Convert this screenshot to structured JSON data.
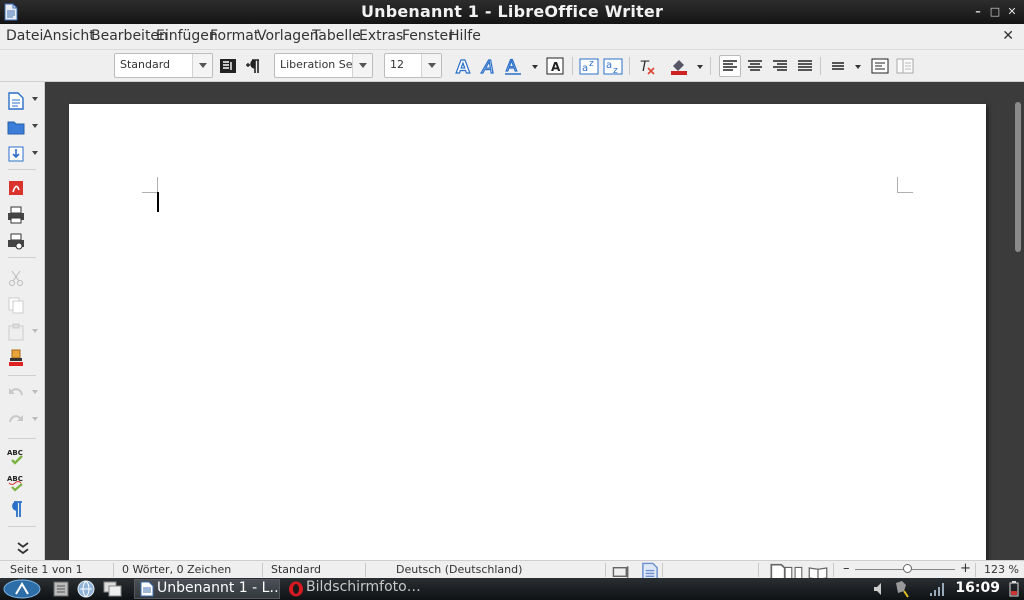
{
  "window": {
    "title": "Unbenannt 1 - LibreOffice Writer",
    "controls": {
      "minimize": "–",
      "maximize": "□",
      "close": "✕"
    }
  },
  "menubar": {
    "items": [
      "Datei",
      "Ansicht",
      "Bearbeiten",
      "Einfügen",
      "Format",
      "Vorlagen",
      "Tabelle",
      "Extras",
      "Fenster",
      "Hilfe"
    ],
    "close_doc": "✕"
  },
  "toolbar": {
    "paragraph_style": "Standard",
    "font_name": "Liberation Serif",
    "font_size": "12",
    "alignment_selected": "left"
  },
  "sidebar": {
    "tools": [
      "new-document",
      "open",
      "save",
      "export-pdf",
      "print",
      "print-preview",
      "cut",
      "copy",
      "paste",
      "clone-formatting",
      "undo",
      "redo",
      "spellcheck",
      "autospellcheck",
      "formatting-marks",
      "more"
    ]
  },
  "document": {
    "text": ""
  },
  "statusbar": {
    "page": "Seite 1 von 1",
    "words": "0 Wörter, 0 Zeichen",
    "style": "Standard",
    "language": "Deutsch (Deutschland)",
    "zoom": "123 %"
  },
  "taskbar": {
    "tasks": [
      {
        "label": "Unbenannt 1 - L…",
        "active": true
      },
      {
        "label": "Bildschirmfoto…",
        "active": false
      }
    ],
    "clock": "16:09"
  }
}
